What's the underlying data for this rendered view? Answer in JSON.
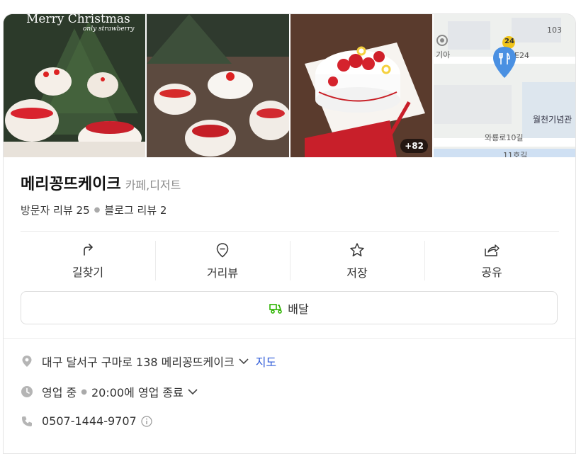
{
  "gallery": {
    "photo1": {
      "heading": "Merry Christmas",
      "subheading": "only strawberry"
    },
    "more_count": "+82",
    "map": {
      "labels": {
        "num_103": "103",
        "giya": "기아",
        "route_24": "24",
        "route_e24": "E24",
        "wolcheon": "월천기념관",
        "waryong": "와룡로10길",
        "bottom": "11호길"
      }
    }
  },
  "place": {
    "name": "메리꽁뜨케이크",
    "category": "카페,디저트",
    "visitor_reviews": "방문자 리뷰 25",
    "blog_reviews": "블로그 리뷰 2"
  },
  "actions": [
    {
      "label": "길찾기",
      "icon": "directions-icon"
    },
    {
      "label": "거리뷰",
      "icon": "streetview-icon"
    },
    {
      "label": "저장",
      "icon": "star-icon"
    },
    {
      "label": "공유",
      "icon": "share-icon"
    }
  ],
  "delivery": {
    "label": "배달",
    "icon": "delivery-scooter-icon",
    "color": "#2db400"
  },
  "info": {
    "address": "대구 달서구 구마로 138 메리꽁뜨케이크",
    "map_link": "지도",
    "hours_status": "영업 중",
    "hours_detail": "20:00에 영업 종료",
    "phone": "0507-1444-9707"
  },
  "colors": {
    "map_pin": "#4a90e2",
    "link": "#2f5bd8",
    "delivery_green": "#2db400"
  }
}
